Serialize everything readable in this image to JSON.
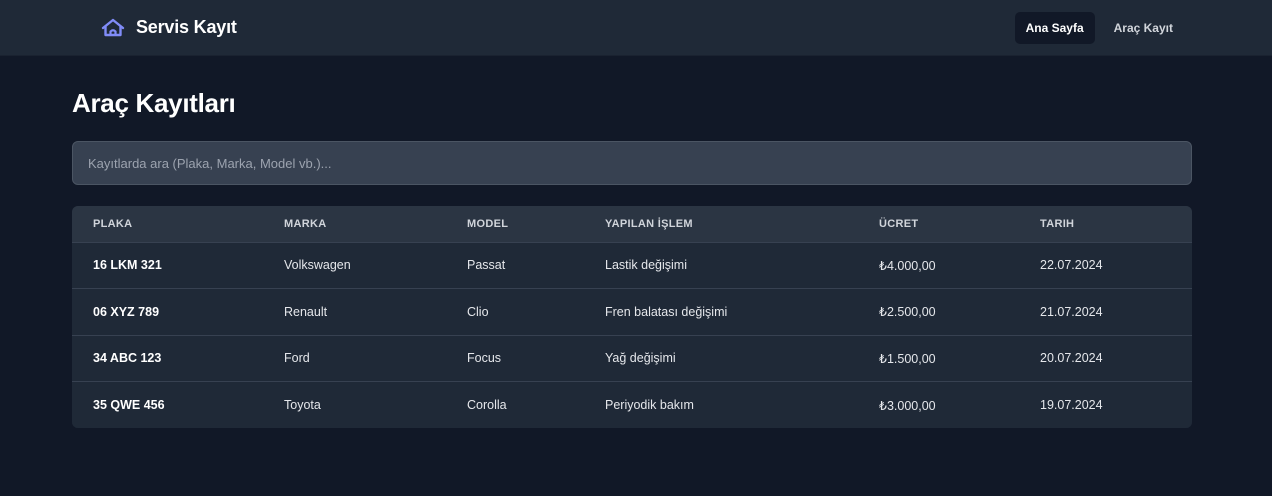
{
  "navbar": {
    "brand_title": "Servis Kayıt",
    "brand_icon": "home-icon",
    "brand_color": "#818cf8",
    "links": [
      {
        "label": "Ana Sayfa",
        "active": true
      },
      {
        "label": "Araç Kayıt",
        "active": false
      }
    ]
  },
  "main": {
    "title": "Araç Kayıtları",
    "search": {
      "placeholder": "Kayıtlarda ara (Plaka, Marka, Model vb.)...",
      "value": ""
    }
  },
  "table": {
    "headers": [
      "PLAKA",
      "MARKA",
      "MODEL",
      "YAPILAN İŞLEM",
      "ÜCRET",
      "TARIH"
    ],
    "rows": [
      [
        "16 LKM 321",
        "Volkswagen",
        "Passat",
        "Lastik değişimi",
        "₺4.000,00",
        "22.07.2024"
      ],
      [
        "06 XYZ 789",
        "Renault",
        "Clio",
        "Fren balatası değişimi",
        "₺2.500,00",
        "21.07.2024"
      ],
      [
        "34 ABC 123",
        "Ford",
        "Focus",
        "Yağ değişimi",
        "₺1.500,00",
        "20.07.2024"
      ],
      [
        "35 QWE 456",
        "Toyota",
        "Corolla",
        "Periyodik bakım",
        "₺3.000,00",
        "19.07.2024"
      ]
    ]
  }
}
